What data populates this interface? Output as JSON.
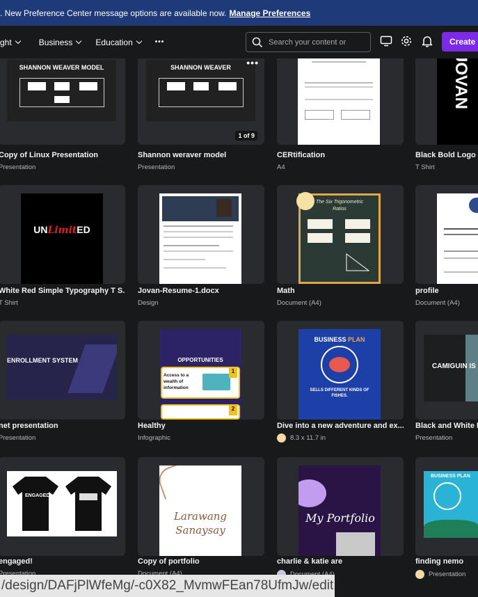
{
  "banner": {
    "message": ". New Preference Center message options are available now.",
    "link": "Manage Preferences"
  },
  "nav": {
    "items": [
      "ght",
      "Business",
      "Education"
    ],
    "more": "•••"
  },
  "search": {
    "placeholder": "Search your content or"
  },
  "create_label": "Create a",
  "thumb_text": {
    "shannon": "SHANNON WEAVER MODEL",
    "shannon2": "SHANNON WEAVER",
    "page_badge": "1 of 9",
    "unlimited_a": "UN",
    "unlimited_b": "Limit",
    "unlimited_c": "ED",
    "math_title": "The Six Trigonometric",
    "math_sub": "Ratios",
    "enrollment": "ENROLLMENT SYSTEM",
    "opportunities": "OPPORTUNITIES",
    "wealth": "Access to a wealth of information",
    "num1": "1",
    "num2": "2",
    "business": "BUSINESS",
    "plan": "PLAN",
    "fishes": "SELLS DIFFERENT KINDS OF FISHES.",
    "camiguin": "CAMIGUIN IS",
    "engaged": "ENGAGED",
    "larawang": "Larawang",
    "sanaysay": "Sanaysay",
    "portfolio": "My Portfolio",
    "bizplan": "BUSINESS PLAN"
  },
  "cards": [
    {
      "title": "Copy of Linux Presentation",
      "sub": "Presentation"
    },
    {
      "title": "Shannon weraver model",
      "sub": "Presentation"
    },
    {
      "title": "CERtification",
      "sub": "A4"
    },
    {
      "title": "Black Bold Logo T",
      "sub": "T Shirt"
    },
    {
      "title": "White Red Simple Typography T S...",
      "sub": "T Shirt"
    },
    {
      "title": "Jovan-Resume-1.docx",
      "sub": "Design"
    },
    {
      "title": "Math",
      "sub": "Document (A4)"
    },
    {
      "title": "profile",
      "sub": "Document (A4)"
    },
    {
      "title": "net presentation",
      "sub": "Presentation"
    },
    {
      "title": "Healthy",
      "sub": "Infographic"
    },
    {
      "title": "Dive into a new adventure and ex...",
      "sub": "8.3 x 11.7 in"
    },
    {
      "title": "Black and White M",
      "sub": "Presentation"
    },
    {
      "title": "engaged!",
      "sub": "Presentation"
    },
    {
      "title": "Copy of portfolio",
      "sub": "Document (A4)"
    },
    {
      "title": "charlie & katie are",
      "sub": "Document (A4)"
    },
    {
      "title": "finding nemo",
      "sub": "Presentation"
    }
  ],
  "status_url": "/design/DAFjPlWfeMg/-c0X82_MvmwFEan78UfmJw/edit",
  "colors": {
    "banner": "#1e3a78",
    "accent": "#7d2ae8",
    "bg": "#18191b",
    "card": "#2a2b2e"
  }
}
